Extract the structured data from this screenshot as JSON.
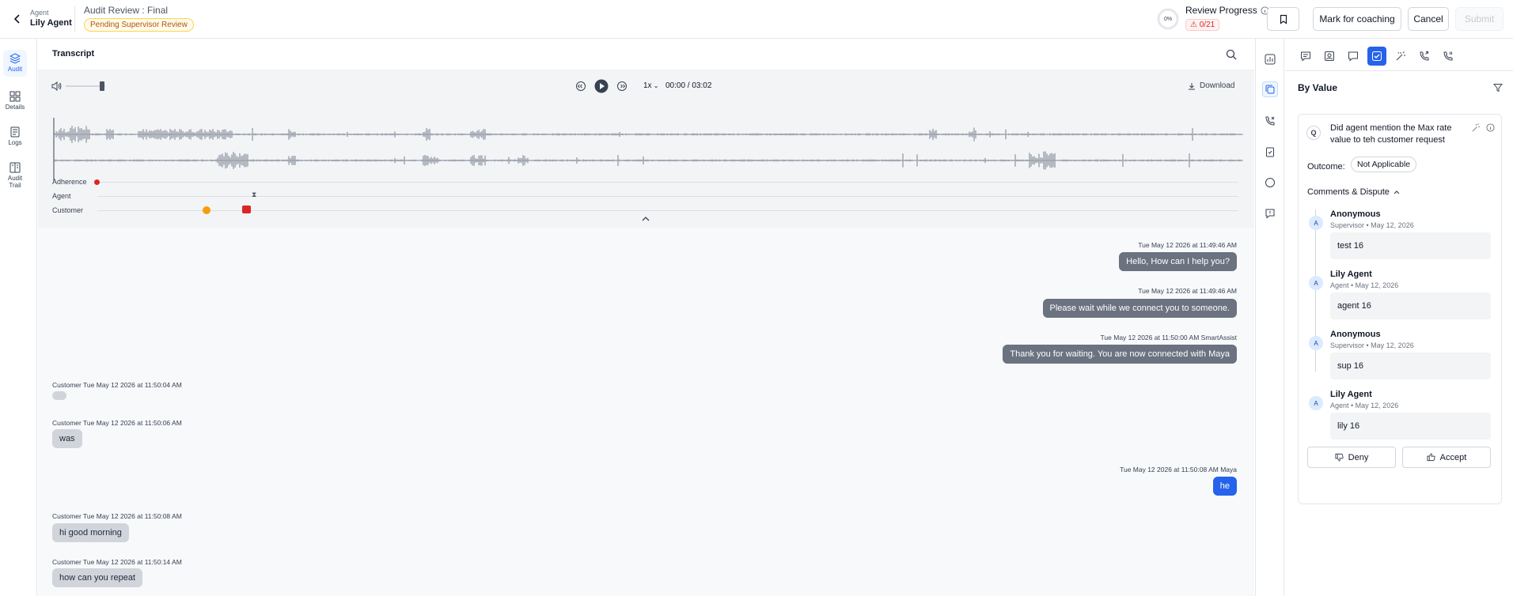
{
  "header": {
    "agent_label": "Agent",
    "agent_name": "Lily Agent",
    "audit_title": "Audit Review : Final",
    "status": "Pending Supervisor Review",
    "progress_percent": "0%",
    "review_progress_label": "Review Progress",
    "review_progress_count": "0/21",
    "mark_coaching": "Mark for coaching",
    "cancel": "Cancel",
    "submit": "Submit"
  },
  "leftnav": {
    "items": [
      {
        "label": "Audit",
        "icon": "layers-icon",
        "active": true
      },
      {
        "label": "Details",
        "icon": "grid-icon"
      },
      {
        "label": "Logs",
        "icon": "logs-icon"
      },
      {
        "label": "Audit Trail",
        "icon": "book-icon"
      }
    ]
  },
  "transcript": {
    "title": "Transcript",
    "speed": "1x",
    "time": "00:00 / 03:02",
    "download": "Download",
    "tracks": {
      "adherence": "Adherence",
      "agent": "Agent",
      "customer": "Customer"
    }
  },
  "messages": [
    {
      "side": "right",
      "meta": "Tue May 12 2026 at 11:49:46 AM",
      "text": "Hello, How can I help you?",
      "color": "gray"
    },
    {
      "side": "right",
      "meta": "Tue May 12 2026 at 11:49:46 AM",
      "text": "Please wait while we connect you to someone.",
      "color": "gray"
    },
    {
      "side": "right",
      "meta": "Tue May 12 2026 at 11:50:00 AM SmartAssist",
      "text": "Thank you for waiting. You are now connected with Maya",
      "color": "gray"
    },
    {
      "side": "left",
      "meta": "Customer  Tue May 12 2026 at 11:50:04 AM",
      "text": ""
    },
    {
      "side": "left",
      "meta": "Customer  Tue May 12 2026 at 11:50:06 AM",
      "text": "was"
    },
    {
      "side": "right",
      "meta": "Tue May 12 2026 at 11:50:08 AM Maya",
      "text": "he",
      "color": "blue"
    },
    {
      "side": "left",
      "meta": "Customer  Tue May 12 2026 at 11:50:08 AM",
      "text": "hi good morning"
    },
    {
      "side": "left",
      "meta": "Customer  Tue May 12 2026 at 11:50:14 AM",
      "text": "how can you repeat"
    }
  ],
  "panel": {
    "by_value": "By Value",
    "question_badge": "Q",
    "question": "Did agent mention the Max rate value to teh customer request",
    "outcome_label": "Outcome:",
    "outcome_value": "Not Applicable",
    "comments_title": "Comments & Dispute",
    "comments": [
      {
        "avatar": "A",
        "name": "Anonymous",
        "role": "Supervisor • May 12, 2026",
        "text": "test 16"
      },
      {
        "avatar": "A",
        "name": "Lily Agent",
        "role": "Agent • May 12, 2026",
        "text": "agent 16"
      },
      {
        "avatar": "A",
        "name": "Anonymous",
        "role": "Supervisor • May 12, 2026",
        "text": "sup 16"
      },
      {
        "avatar": "A",
        "name": "Lily Agent",
        "role": "Agent • May 12, 2026",
        "text": "lily 16"
      }
    ],
    "deny": "Deny",
    "accept": "Accept"
  },
  "colors": {
    "accent": "#2563eb",
    "agent_bubble": "#6b7280",
    "customer_bubble": "#d1d5db",
    "badge_warning": "#b45309",
    "badge_error": "#dc2626"
  }
}
